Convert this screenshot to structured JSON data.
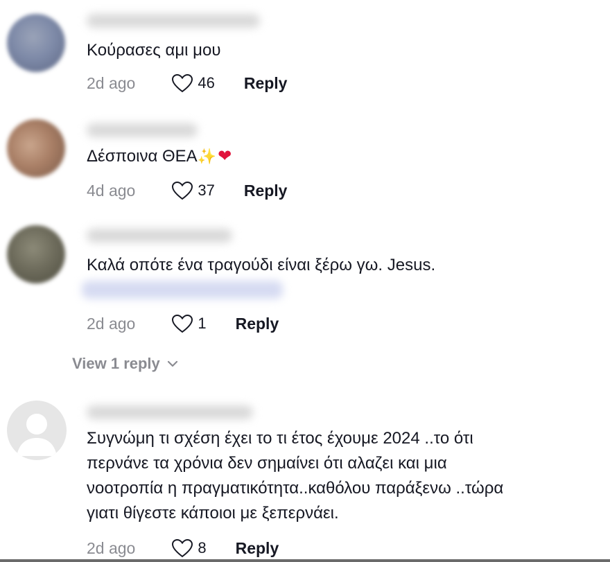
{
  "comments": [
    {
      "text": "Κούρασες αμι μου",
      "time": "2d ago",
      "likes": "46",
      "reply_label": "Reply"
    },
    {
      "text": "Δέσποινα ΘΕΑ",
      "emoji_1": "✨",
      "emoji_2": "❤",
      "time": "4d ago",
      "likes": "37",
      "reply_label": "Reply"
    },
    {
      "text": "Καλά οπότε ένα τραγούδι είναι ξέρω γω. Jesus.",
      "time": "2d ago",
      "likes": "1",
      "reply_label": "Reply",
      "view_replies": "View 1 reply"
    },
    {
      "text_lines": [
        "Συγνώμη τι σχέση έχει το τι έτος έχουμε 2024 ..το ότι",
        "περνάνε τα χρόνια δεν σημαίνει ότι αλαζει και μια",
        "νοοτροπία η πραγματικότητα..καθόλου παράξενω ..τώρα",
        "γιατι θίγεστε κάποιοι με ξεπερνάει."
      ],
      "time": "2d ago",
      "likes": "8",
      "reply_label": "Reply"
    }
  ],
  "icons": {
    "like": "heart-outline-icon",
    "expand": "chevron-down-icon",
    "default_avatar": "user-silhouette-icon"
  },
  "colors": {
    "text": "#161823",
    "muted": "#8a8b91"
  }
}
